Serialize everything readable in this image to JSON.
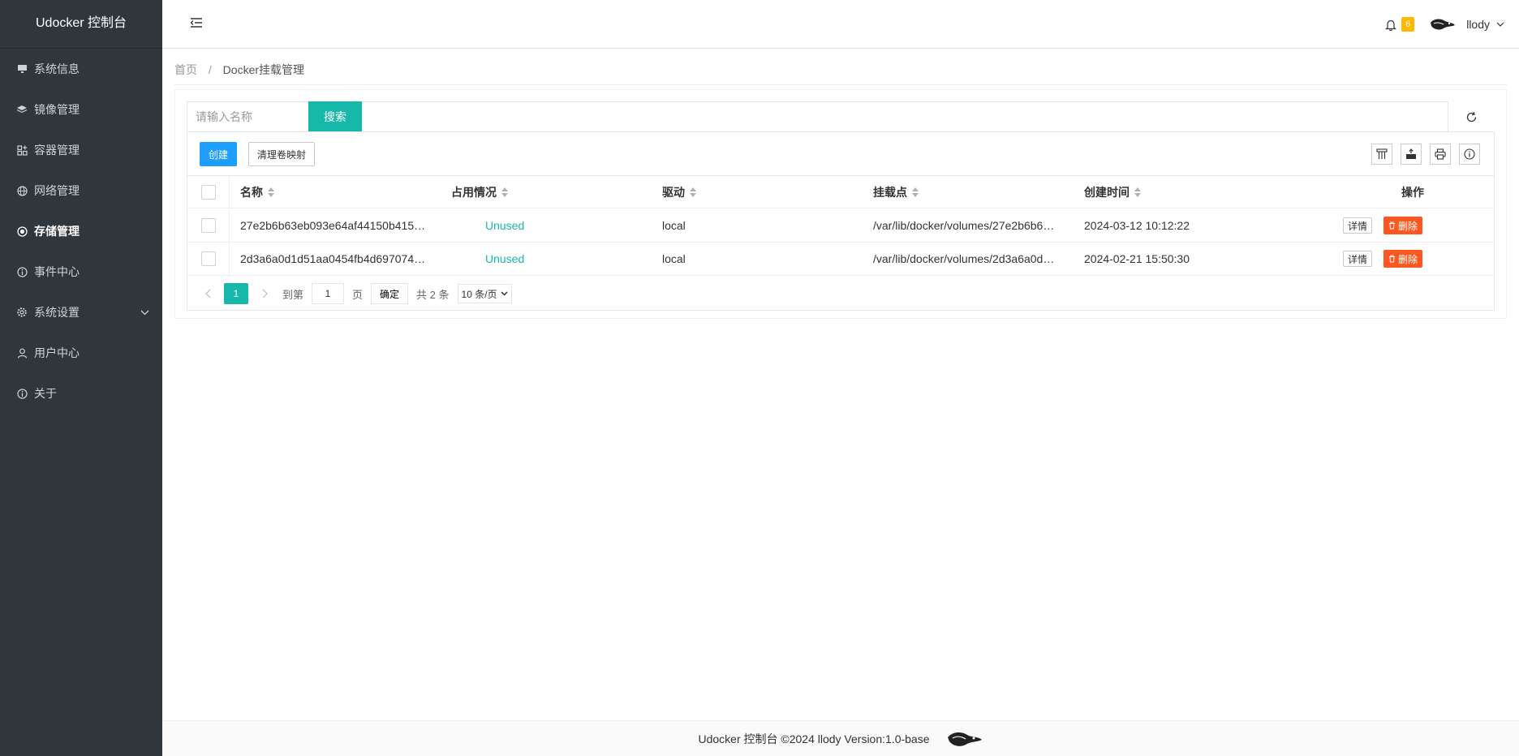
{
  "app": {
    "title": "Udocker 控制台"
  },
  "sidebar": {
    "items": [
      {
        "label": "系统信息",
        "icon": "monitor-icon"
      },
      {
        "label": "镜像管理",
        "icon": "layers-icon"
      },
      {
        "label": "容器管理",
        "icon": "grid-icon"
      },
      {
        "label": "网络管理",
        "icon": "globe-icon"
      },
      {
        "label": "存储管理",
        "icon": "disk-icon",
        "active": true
      },
      {
        "label": "事件中心",
        "icon": "info-icon"
      },
      {
        "label": "系统设置",
        "icon": "gear-icon",
        "expandable": true
      },
      {
        "label": "用户中心",
        "icon": "user-icon"
      },
      {
        "label": "关于",
        "icon": "info-icon"
      }
    ]
  },
  "header": {
    "notification_count": "6",
    "username": "llody"
  },
  "breadcrumb": {
    "home": "首页",
    "separator": "/",
    "current": "Docker挂载管理"
  },
  "search": {
    "placeholder": "请输入名称",
    "button": "搜索"
  },
  "toolbar": {
    "create": "创建",
    "clean": "清理卷映射"
  },
  "table": {
    "columns": [
      "名称",
      "占用情况",
      "驱动",
      "挂载点",
      "创建时间",
      "操作"
    ],
    "rows": [
      {
        "name": "27e2b6b63eb093e64af44150b415…",
        "usage": "Unused",
        "driver": "local",
        "mountpoint": "/var/lib/docker/volumes/27e2b6b6…",
        "created": "2024-03-12 10:12:22"
      },
      {
        "name": "2d3a6a0d1d51aa0454fb4d697074…",
        "usage": "Unused",
        "driver": "local",
        "mountpoint": "/var/lib/docker/volumes/2d3a6a0d…",
        "created": "2024-02-21 15:50:30"
      }
    ],
    "actions": {
      "detail": "详情",
      "delete": "删除"
    }
  },
  "pagination": {
    "current": "1",
    "goto_label": "到第",
    "goto_value": "1",
    "page_label": "页",
    "confirm": "确定",
    "total": "共 2 条",
    "page_size": "10 条/页"
  },
  "footer": {
    "text": "Udocker 控制台 ©2024 llody Version:1.0-base"
  },
  "colors": {
    "sidebar": "#2f363c",
    "primary": "#16b9a9",
    "blue": "#1e9fff",
    "danger": "#ff5722",
    "badge": "#ffb800"
  }
}
